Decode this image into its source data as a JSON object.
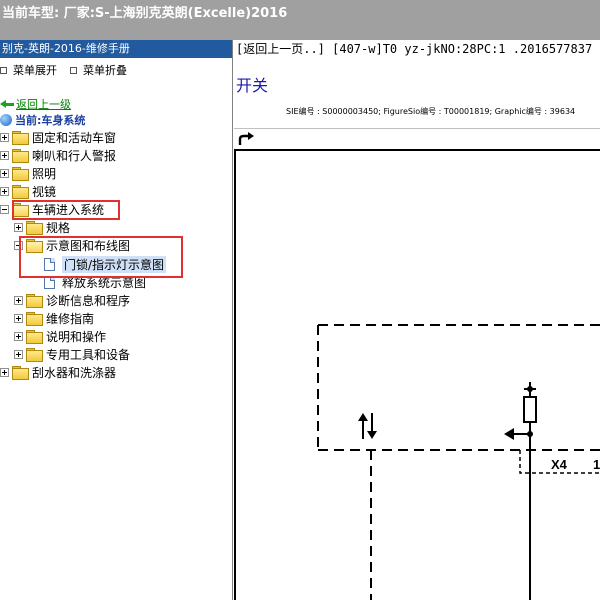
{
  "app": {
    "title": "当前车型:  厂家:S-上海别克英朗(Excelle)2016"
  },
  "left_panel": {
    "title": "别克-英朗-2016-维修手册",
    "menu_expand": "菜单展开",
    "menu_collapse": "菜单折叠",
    "back_link": "返回上一级",
    "current_label": "当前:车身系统",
    "tree": [
      {
        "label": "固定和活动车窗",
        "level": 0,
        "type": "folder",
        "state": "collapsed"
      },
      {
        "label": "喇叭和行人警报",
        "level": 0,
        "type": "folder",
        "state": "collapsed"
      },
      {
        "label": "照明",
        "level": 0,
        "type": "folder",
        "state": "collapsed"
      },
      {
        "label": "视镜",
        "level": 0,
        "type": "folder",
        "state": "collapsed"
      },
      {
        "label": "车辆进入系统",
        "level": 0,
        "type": "folder",
        "state": "expanded"
      },
      {
        "label": "规格",
        "level": 1,
        "type": "folder",
        "state": "collapsed"
      },
      {
        "label": "示意图和布线图",
        "level": 1,
        "type": "folder",
        "state": "expanded"
      },
      {
        "label": "门锁/指示灯示意图",
        "level": 2,
        "type": "doc",
        "selected": true
      },
      {
        "label": "释放系统示意图",
        "level": 2,
        "type": "doc"
      },
      {
        "label": "诊断信息和程序",
        "level": 1,
        "type": "folder",
        "state": "collapsed"
      },
      {
        "label": "维修指南",
        "level": 1,
        "type": "folder",
        "state": "collapsed"
      },
      {
        "label": "说明和操作",
        "level": 1,
        "type": "folder",
        "state": "collapsed"
      },
      {
        "label": "专用工具和设备",
        "level": 1,
        "type": "folder",
        "state": "collapsed"
      },
      {
        "label": "刮水器和洗涤器",
        "level": 0,
        "type": "folder",
        "state": "collapsed"
      }
    ]
  },
  "right_panel": {
    "nav_text": "[返回上一页..] [407-w]T0 yz-jkNO:28PC:1 .2016577837",
    "section_title": "开关",
    "meta": "SIE编号 : S0000003450;  FigureSio编号 : T00001819;  Graphic编号 : 39634",
    "diagram": {
      "connector_label": "X4",
      "pin_label": "1"
    }
  },
  "colors": {
    "title_bar": "#a0a0a0",
    "panel_header": "#215a9e",
    "highlight_box": "#e03030",
    "section_title": "#1a1ab0",
    "back_link": "#008000",
    "current_label": "#1a3f9e"
  },
  "icons": {
    "back": "green-left-arrow-icon",
    "current": "globe-icon",
    "folder": "folder-icon",
    "document": "document-icon",
    "toolbar": "curved-arrow-icon"
  }
}
